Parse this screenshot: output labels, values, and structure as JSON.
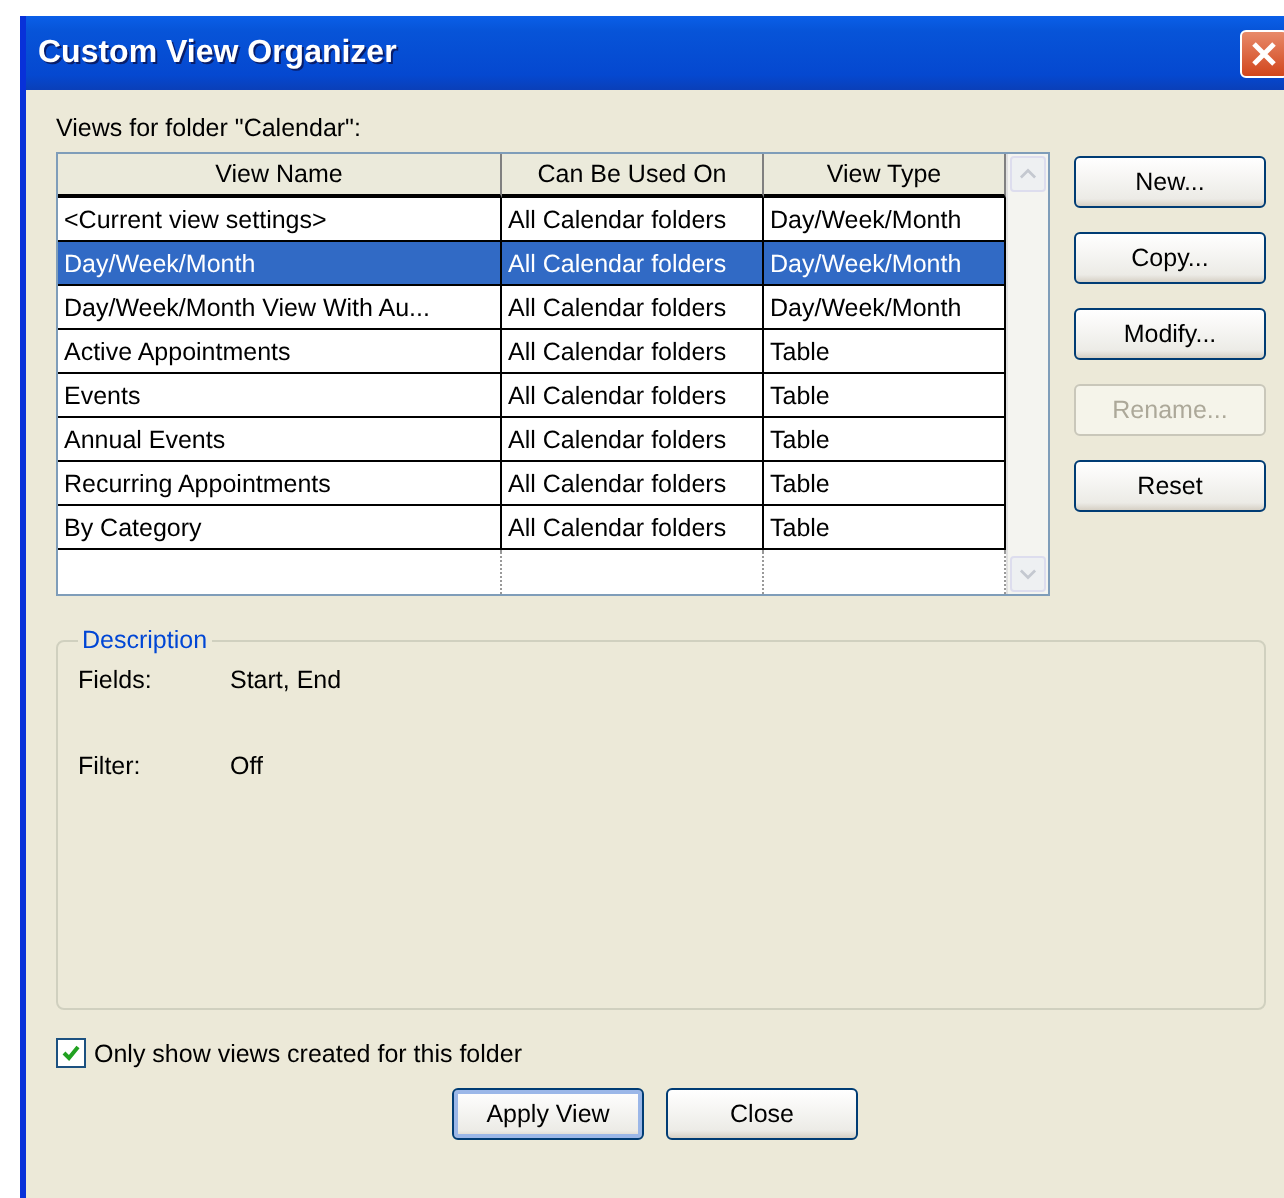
{
  "window": {
    "title": "Custom View Organizer"
  },
  "views_label": "Views for folder \"Calendar\":",
  "table": {
    "columns": [
      "View Name",
      "Can Be Used On",
      "View Type"
    ],
    "rows": [
      {
        "cells": [
          "<Current view settings>",
          "All Calendar folders",
          "Day/Week/Month"
        ],
        "selected": false
      },
      {
        "cells": [
          "Day/Week/Month",
          "All Calendar folders",
          "Day/Week/Month"
        ],
        "selected": true
      },
      {
        "cells": [
          "Day/Week/Month View With Au...",
          "All Calendar folders",
          "Day/Week/Month"
        ],
        "selected": false
      },
      {
        "cells": [
          "Active Appointments",
          "All Calendar folders",
          "Table"
        ],
        "selected": false
      },
      {
        "cells": [
          "Events",
          "All Calendar folders",
          "Table"
        ],
        "selected": false
      },
      {
        "cells": [
          "Annual Events",
          "All Calendar folders",
          "Table"
        ],
        "selected": false
      },
      {
        "cells": [
          "Recurring Appointments",
          "All Calendar folders",
          "Table"
        ],
        "selected": false
      },
      {
        "cells": [
          "By Category",
          "All Calendar folders",
          "Table"
        ],
        "selected": false
      }
    ]
  },
  "side_buttons": [
    {
      "label": "New...",
      "disabled": false
    },
    {
      "label": "Copy...",
      "disabled": false
    },
    {
      "label": "Modify...",
      "disabled": false
    },
    {
      "label": "Rename...",
      "disabled": true
    },
    {
      "label": "Reset",
      "disabled": false
    }
  ],
  "description": {
    "title": "Description",
    "fields": [
      {
        "label": "Fields:",
        "value": "Start, End"
      },
      {
        "label": "Filter:",
        "value": "Off"
      }
    ]
  },
  "only_show": {
    "label": "Only show views created for this folder",
    "checked": true
  },
  "buttons": [
    {
      "label": "Apply View",
      "default": true
    },
    {
      "label": "Close",
      "default": false
    }
  ]
}
